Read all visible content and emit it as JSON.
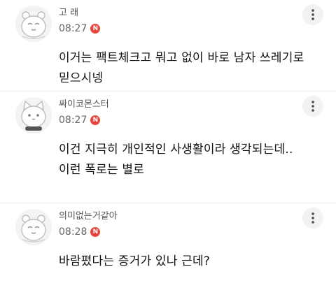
{
  "comments": [
    {
      "nickname": "고 래",
      "time": "08:27",
      "badge": "N",
      "text": "이거는 팩트체크고 뭐고 없이 바로 남자 쓰레기로\n믿으시넹",
      "avatar_icon": "bear-avatar-icon"
    },
    {
      "nickname": "싸이코몬스터",
      "time": "08:27",
      "badge": "N",
      "text": "이건 지극히 개인적인 사생활이라 생각되는데..\n이런 폭로는 별로",
      "avatar_icon": "cat-avatar-icon"
    },
    {
      "nickname": "의미없는거같아",
      "time": "08:28",
      "badge": "N",
      "text": "바람폈다는 증거가 있나 근데?",
      "avatar_icon": "bear-avatar-icon"
    }
  ],
  "more_icon": "more-vertical-icon",
  "colors": {
    "badge": "#e8453c",
    "divider": "#ececec",
    "meta_text": "#666666"
  }
}
